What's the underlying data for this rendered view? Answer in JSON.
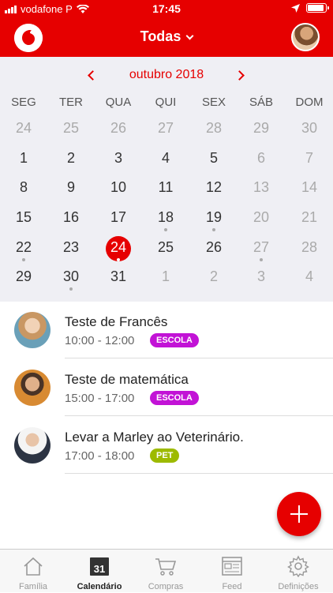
{
  "status": {
    "carrier": "vodafone P",
    "time": "17:45"
  },
  "header": {
    "title": "Todas"
  },
  "calendar": {
    "month": "outubro 2018",
    "weekdays": [
      "SEG",
      "TER",
      "QUA",
      "QUI",
      "SEX",
      "SÁB",
      "DOM"
    ],
    "weeks": [
      [
        "24",
        "25",
        "26",
        "27",
        "28",
        "29",
        "30"
      ],
      [
        "1",
        "2",
        "3",
        "4",
        "5",
        "6",
        "7"
      ],
      [
        "8",
        "9",
        "10",
        "11",
        "12",
        "13",
        "14"
      ],
      [
        "15",
        "16",
        "17",
        "18",
        "19",
        "20",
        "21"
      ],
      [
        "22",
        "23",
        "24",
        "25",
        "26",
        "27",
        "28"
      ],
      [
        "29",
        "30",
        "31",
        "1",
        "2",
        "3",
        "4"
      ]
    ],
    "selected_day": "24"
  },
  "events": [
    {
      "title": "Teste de Francês",
      "time": "10:00 - 12:00",
      "tag": "ESCOLA",
      "tag_color": "#c213d6"
    },
    {
      "title": "Teste de matemática",
      "time": "15:00 - 17:00",
      "tag": "ESCOLA",
      "tag_color": "#c213d6"
    },
    {
      "title": "Levar a Marley ao Veterinário.",
      "time": "17:00 - 18:00",
      "tag": "PET",
      "tag_color": "#9dba00"
    }
  ],
  "tabs": [
    {
      "label": "Família",
      "icon": "home-icon"
    },
    {
      "label": "Calendário",
      "icon": "calendar-icon",
      "badge": "31"
    },
    {
      "label": "Compras",
      "icon": "cart-icon"
    },
    {
      "label": "Feed",
      "icon": "feed-icon"
    },
    {
      "label": "Definições",
      "icon": "gear-icon"
    }
  ],
  "colors": {
    "brand": "#e60000"
  }
}
